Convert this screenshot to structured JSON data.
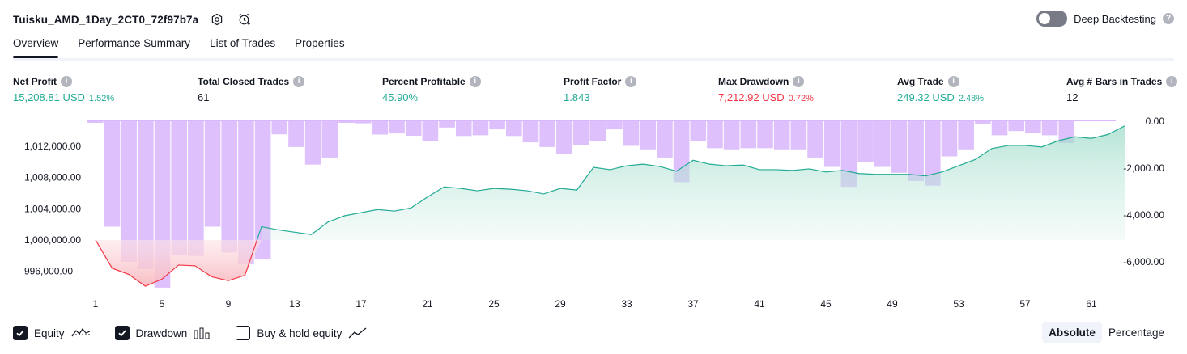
{
  "header": {
    "strategy_title": "Tuisku_AMD_1Day_2CT0_72f97b7a",
    "icons": [
      "settings-icon",
      "add-alert-icon"
    ],
    "deep_backtesting_label": "Deep Backtesting",
    "deep_backtesting_on": false
  },
  "tabs": [
    {
      "label": "Overview",
      "active": true
    },
    {
      "label": "Performance Summary",
      "active": false
    },
    {
      "label": "List of Trades",
      "active": false
    },
    {
      "label": "Properties",
      "active": false
    }
  ],
  "metrics": {
    "net_profit": {
      "label": "Net Profit",
      "value": "15,208.81 USD",
      "pct": "1.52%"
    },
    "total_closed_trades": {
      "label": "Total Closed Trades",
      "value": "61"
    },
    "percent_profitable": {
      "label": "Percent Profitable",
      "value": "45.90%"
    },
    "profit_factor": {
      "label": "Profit Factor",
      "value": "1.843"
    },
    "max_drawdown": {
      "label": "Max Drawdown",
      "value": "7,212.92 USD",
      "pct": "0.72%"
    },
    "avg_trade": {
      "label": "Avg Trade",
      "value": "249.32 USD",
      "pct": "2.48%"
    },
    "avg_bars": {
      "label": "Avg # Bars in Trades",
      "value": "12"
    }
  },
  "colors": {
    "positive": "#22ab94",
    "negative": "#f23645",
    "drawdown_bar": "#d9b8fc",
    "equity_line": "#22ab94",
    "equity_fill": "#d4efe8",
    "below_start_fill": "#f8b9c0"
  },
  "chart_data": {
    "type": "area",
    "x_ticks": [
      1,
      5,
      9,
      13,
      17,
      21,
      25,
      29,
      33,
      37,
      41,
      45,
      49,
      53,
      57,
      61
    ],
    "left_axis": {
      "ticks": [
        "1,012,000.00",
        "1,008,000.00",
        "1,004,000.00",
        "1,000,000.00",
        "996,000.00"
      ],
      "values": [
        1012000,
        1008000,
        1004000,
        1000000,
        996000
      ]
    },
    "right_axis": {
      "ticks": [
        "0.00",
        "-2,000.00",
        "-4,000.00",
        "-6,000.00"
      ],
      "values": [
        0,
        -2000,
        -4000,
        -6000
      ]
    },
    "baseline": 1000000,
    "series": [
      {
        "name": "Equity",
        "values": [
          1000000,
          996400,
          995600,
          994100,
          995000,
          996800,
          996700,
          995300,
          994800,
          995500,
          1001700,
          1001300,
          1001000,
          1000700,
          1002300,
          1003100,
          1003500,
          1003900,
          1003700,
          1004100,
          1005500,
          1006800,
          1006600,
          1006300,
          1006600,
          1006500,
          1006300,
          1005900,
          1006600,
          1006400,
          1009300,
          1009000,
          1009500,
          1009700,
          1009400,
          1008800,
          1010200,
          1009700,
          1009500,
          1009600,
          1009000,
          1009000,
          1008900,
          1009100,
          1008700,
          1008900,
          1008500,
          1008400,
          1008400,
          1008400,
          1008200,
          1008700,
          1009500,
          1010300,
          1011700,
          1012100,
          1012100,
          1011900,
          1012700,
          1013200,
          1013000,
          1013500,
          1014600
        ]
      },
      {
        "name": "Drawdown",
        "values": [
          -70,
          -4500,
          -6000,
          -6300,
          -7100,
          -5700,
          -5750,
          -4500,
          -5600,
          -6100,
          -5900,
          -560,
          -1100,
          -1850,
          -1550,
          -70,
          -90,
          -570,
          -520,
          -620,
          -860,
          -270,
          -630,
          -600,
          -350,
          -630,
          -900,
          -1100,
          -1400,
          -1000,
          -850,
          -350,
          -1050,
          -1200,
          -1550,
          -2600,
          -850,
          -1150,
          -1200,
          -1150,
          -1150,
          -1200,
          -1200,
          -1550,
          -1950,
          -2800,
          -1750,
          -1950,
          -2200,
          -2550,
          -2750,
          -1500,
          -1200,
          -120,
          -600,
          -420,
          -500,
          -600,
          -930
        ]
      }
    ]
  },
  "legend": [
    {
      "label": "Equity",
      "checked": true,
      "icon": "equity-line-icon"
    },
    {
      "label": "Drawdown",
      "checked": true,
      "icon": "drawdown-bars-icon"
    },
    {
      "label": "Buy & hold equity",
      "checked": false,
      "icon": "buy-hold-line-icon"
    }
  ],
  "modes": [
    {
      "label": "Absolute",
      "active": true
    },
    {
      "label": "Percentage",
      "active": false
    }
  ]
}
